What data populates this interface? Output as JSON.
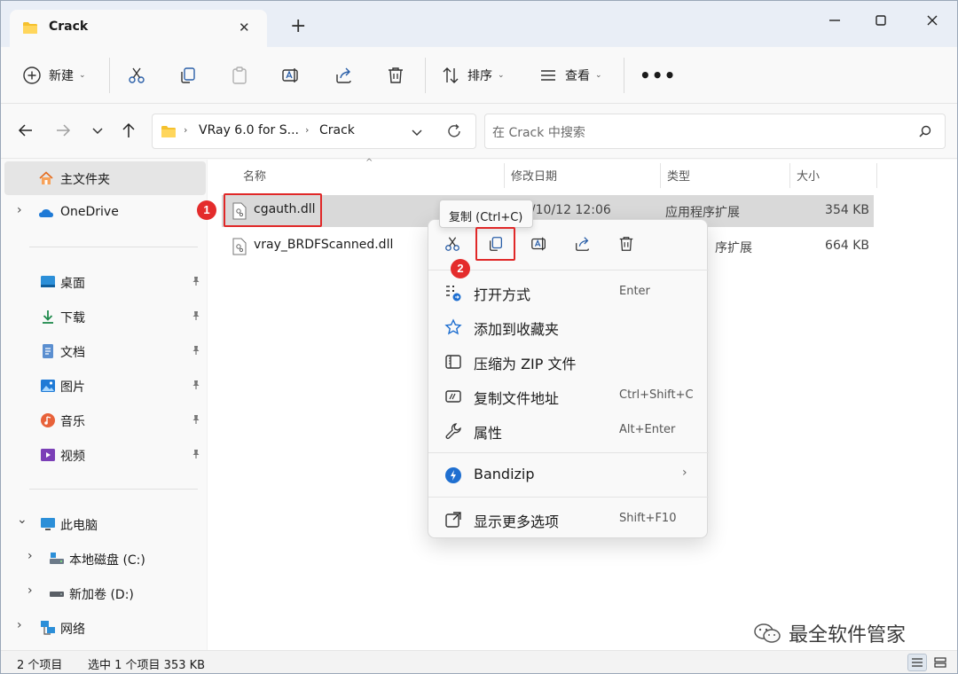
{
  "window": {
    "tab_title": "Crack",
    "tab_close": "✕",
    "new_tab": "+"
  },
  "toolbar": {
    "new_label": "新建",
    "sort_label": "排序",
    "view_label": "查看",
    "more": "•••",
    "caret": "⌄"
  },
  "address": {
    "crumb1": "VRay 6.0 for S...",
    "crumb2": "Crack",
    "sep": "›"
  },
  "search": {
    "placeholder": "在 Crack 中搜索"
  },
  "sidebar": {
    "home": "主文件夹",
    "onedrive": "OneDrive",
    "desktop": "桌面",
    "downloads": "下载",
    "documents": "文档",
    "pictures": "图片",
    "music": "音乐",
    "videos": "视频",
    "thispc": "此电脑",
    "drive_c": "本地磁盘 (C:)",
    "drive_d": "新加卷 (D:)",
    "network": "网络",
    "chev_right": "›",
    "chev_down": "⌄",
    "pin": "📌"
  },
  "columns": {
    "name": "名称",
    "date": "修改日期",
    "type": "类型",
    "size": "大小",
    "sort_caret": "^"
  },
  "files": [
    {
      "name": "cgauth.dll",
      "date": "2/10/12 12:06",
      "type": "应用程序扩展",
      "size": "354 KB"
    },
    {
      "name": "vray_BRDFScanned.dll",
      "date": "",
      "type": "序扩展",
      "size": "664 KB"
    }
  ],
  "context_menu": {
    "tooltip": "复制 (Ctrl+C)",
    "items": [
      {
        "label": "打开方式",
        "key": "Enter"
      },
      {
        "label": "添加到收藏夹",
        "key": ""
      },
      {
        "label": "压缩为 ZIP 文件",
        "key": ""
      },
      {
        "label": "复制文件地址",
        "key": "Ctrl+Shift+C"
      },
      {
        "label": "属性",
        "key": "Alt+Enter"
      },
      {
        "label": "Bandizip",
        "key": "",
        "arrow": "›"
      },
      {
        "label": "显示更多选项",
        "key": "Shift+F10"
      }
    ]
  },
  "status": {
    "count": "2 个项目",
    "selected": "选中 1 个项目  353 KB"
  },
  "annotations": {
    "badge1": "1",
    "badge2": "2"
  },
  "watermark": {
    "text": "最全软件管家"
  },
  "colors": {
    "accent": "#0067c0",
    "folder": "#f5c12e",
    "highlight": "#e02828",
    "selected_row": "#d9d9d9"
  }
}
